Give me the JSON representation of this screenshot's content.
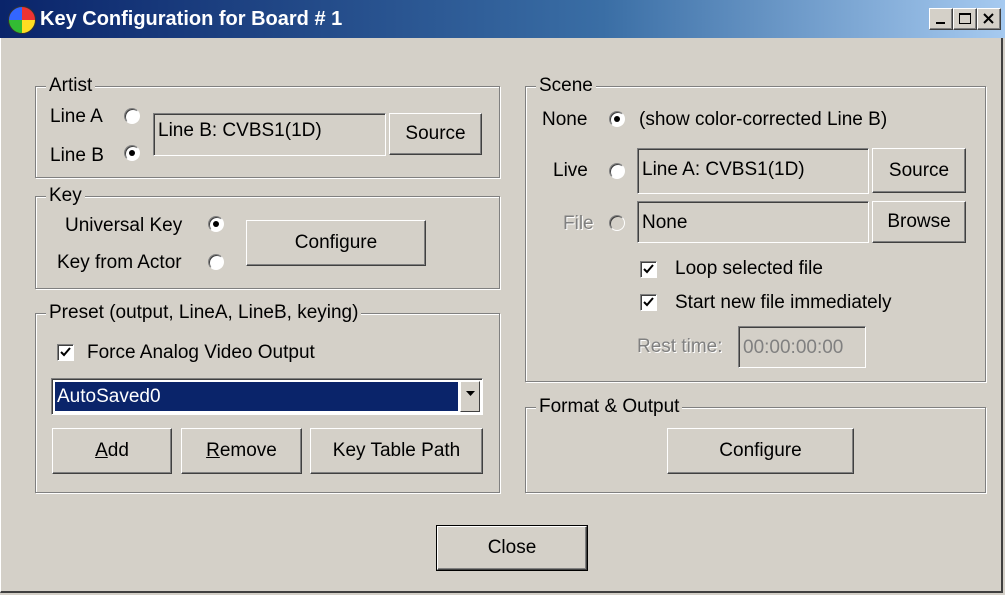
{
  "window": {
    "title": "Key Configuration for Board # 1"
  },
  "artist": {
    "legend": "Artist",
    "line_a_label": "Line A",
    "line_b_label": "Line B",
    "selected": "Line B",
    "source_field": "Line B: CVBS1(1D)",
    "source_button": "Source"
  },
  "key": {
    "legend": "Key",
    "universal_label": "Universal Key",
    "actor_label": "Key from Actor",
    "selected": "Universal Key",
    "configure_button": "Configure"
  },
  "preset": {
    "legend": "Preset (output, LineA, LineB, keying)",
    "force_analog_label": "Force Analog Video Output",
    "force_analog_checked": true,
    "combo_value": "AutoSaved0",
    "add_button_mnemonic": "A",
    "add_button_rest": "dd",
    "remove_button_mnemonic": "R",
    "remove_button_rest": "emove",
    "key_table_button": "Key Table Path"
  },
  "scene": {
    "legend": "Scene",
    "none_label": "None",
    "none_note": "(show color-corrected Line B)",
    "live_label": "Live",
    "file_label": "File",
    "selected": "None",
    "live_field": "Line A: CVBS1(1D)",
    "live_source_button": "Source",
    "file_field": "None",
    "browse_button": "Browse",
    "loop_label": "Loop selected file",
    "loop_checked": true,
    "start_new_label": "Start new file immediately",
    "start_new_checked": true,
    "rest_time_label": "Rest time:",
    "rest_time_value": "00:00:00:00"
  },
  "format_output": {
    "legend": "Format & Output",
    "configure_button": "Configure"
  },
  "footer": {
    "close_button": "Close"
  },
  "colors": {
    "titlebar_start": "#0a246a",
    "titlebar_end": "#a6caf0",
    "face": "#d4d0c8",
    "selection": "#0a246a"
  }
}
